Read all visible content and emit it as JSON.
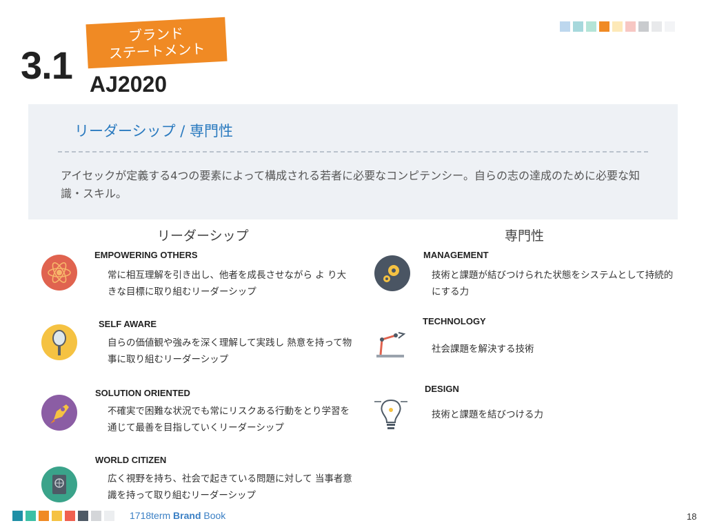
{
  "header": {
    "section_number": "3.1",
    "badge_line1": "ブランド",
    "badge_line2": "ステートメント",
    "code": "AJ2020",
    "swatch_colors": [
      "#bdd7ee",
      "#a6d8dc",
      "#b4e4d7",
      "#f08a24",
      "#fde9b8",
      "#f7c7c3",
      "#c9cbce",
      "#e8e9eb",
      "#f3f4f6"
    ]
  },
  "intro": {
    "title": "リーダーシップ / 専門性",
    "text": "アイセックが定義する4つの要素によって構成される若者に必要なコンピテンシー。自らの志の達成のために必要な知識・スキル。"
  },
  "leadership": {
    "heading": "リーダーシップ",
    "items": [
      {
        "title": "EMPOWERING OTHERS",
        "text": "常に相互理解を引き出し、他者を成長させながら よ り大きな目標に取り組むリーダーシップ",
        "icon": "atom-icon"
      },
      {
        "title": "SELF AWARE",
        "text": "自らの価値観や強みを深く理解して実践し 熱意を持って物事に取り組むリーダーシップ",
        "icon": "mirror-icon"
      },
      {
        "title": "SOLUTION ORIENTED",
        "text": "不確実で困難な状況でも常にリスクある行動をとり学習を通じて最善を目指していくリーダーシップ",
        "icon": "rocket-icon"
      },
      {
        "title": "WORLD CITIZEN",
        "text": "広く視野を持ち、社会で起きている問題に対して 当事者意識を持って取り組むリーダーシップ",
        "icon": "passport-icon"
      }
    ]
  },
  "expertise": {
    "heading": "専門性",
    "items": [
      {
        "title": "MANAGEMENT",
        "text": "技術と課題が結びつけられた状態をシステムとして持続的にする力",
        "icon": "gears-icon"
      },
      {
        "title": "TECHNOLOGY",
        "text": "社会課題を解決する技術",
        "icon": "robot-arm-icon"
      },
      {
        "title": "DESIGN",
        "text": "技術と課題を結びつける力",
        "icon": "lightbulb-pen-icon"
      }
    ]
  },
  "footer": {
    "term": "1718term",
    "brand": "Brand",
    "book": "Book",
    "page_number": "18",
    "swatch_colors": [
      "#1f8fa6",
      "#3cc0a6",
      "#f08a24",
      "#f5c242",
      "#f0604f",
      "#4e5a66",
      "#d4d6d9",
      "#eceef0"
    ]
  }
}
